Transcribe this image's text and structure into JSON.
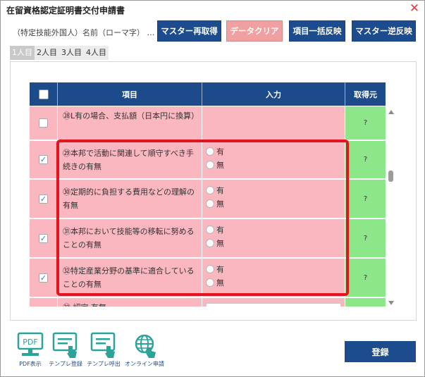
{
  "window": {
    "title": "在留資格認定証明書交付申請書"
  },
  "header": {
    "name_label": "（特定技能外国人）名前（ローマ字）",
    "name_value": "…",
    "buttons": {
      "master_refresh": "マスター再取得",
      "data_clear": "データクリア",
      "bulk_apply": "項目一括反映",
      "master_reverse": "マスター逆反映"
    }
  },
  "tabs": [
    "1人目",
    "2人目",
    "3人目",
    "4人目"
  ],
  "table": {
    "columns": {
      "item": "項目",
      "input": "入力",
      "source": "取得元"
    },
    "rows": [
      {
        "item": "㉘L有の場合、支払額（日本円に換算）",
        "checked": false,
        "source": "?"
      },
      {
        "item": "㉙本邦で活動に関連して順守すべき手続きの有無",
        "checked": true,
        "options": [
          "有",
          "無"
        ],
        "source": "?"
      },
      {
        "item": "㉚定期的に負担する費用などの理解の有無",
        "checked": true,
        "options": [
          "有",
          "無"
        ],
        "source": "?"
      },
      {
        "item": "㉛本邦において技能等の移転に努めることの有無",
        "checked": true,
        "options": [
          "有",
          "無"
        ],
        "source": "?"
      },
      {
        "item": "㉜特定産業分野の基準に適合していることの有無",
        "checked": true,
        "options": [
          "有",
          "無"
        ],
        "source": "?"
      },
      {
        "item": "㉝ 認定 有無",
        "checked": false,
        "source": "?"
      }
    ]
  },
  "footer": {
    "icons": {
      "pdf": {
        "badge": "PDF",
        "label": "PDF表示"
      },
      "template_register": "テンプレ登録",
      "template_call": "テンプレ呼出",
      "online": "オンライン申請"
    },
    "register_button": "登録"
  },
  "colors": {
    "primary": "#1d4c8e",
    "danger_button": "#f0a0a0",
    "row_pink": "#fbb7c0",
    "source_green": "#8ee68a",
    "highlight_red": "#e3141e",
    "close_red": "#e23a3a",
    "icon_teal": "#2aa39a"
  }
}
